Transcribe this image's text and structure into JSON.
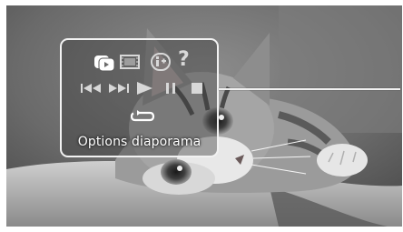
{
  "player": {
    "background_image": "kitten-photo",
    "menu": {
      "row1": [
        {
          "icon": "slideshow-options-icon"
        },
        {
          "icon": "film-strip-icon"
        },
        {
          "icon": "info-icon"
        },
        {
          "icon": "help-icon",
          "glyph": "?"
        }
      ],
      "row2": [
        {
          "icon": "previous-icon"
        },
        {
          "icon": "next-icon"
        },
        {
          "icon": "play-icon"
        },
        {
          "icon": "pause-icon"
        },
        {
          "icon": "stop-icon"
        }
      ],
      "row3": [
        {
          "icon": "repeat-icon"
        }
      ],
      "label": "Options diaporama"
    },
    "colors": {
      "panel_border": "#f2f2f2",
      "icon_active": "#ffffff",
      "icon_inactive": "#d8d8d8"
    }
  }
}
